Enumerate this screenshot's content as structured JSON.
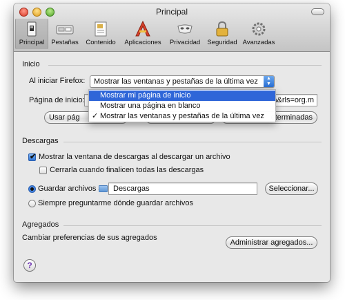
{
  "window": {
    "title": "Principal"
  },
  "toolbar": {
    "tabs": [
      {
        "label": "Principal",
        "icon": "switch-icon"
      },
      {
        "label": "Pestañas",
        "icon": "tabs-icon"
      },
      {
        "label": "Contenido",
        "icon": "content-icon"
      },
      {
        "label": "Aplicaciones",
        "icon": "applications-icon"
      },
      {
        "label": "Privacidad",
        "icon": "privacy-mask-icon"
      },
      {
        "label": "Seguridad",
        "icon": "padlock-icon"
      },
      {
        "label": "Avanzadas",
        "icon": "gear-icon"
      }
    ]
  },
  "inicio": {
    "section_title": "Inicio",
    "startup_label": "Al iniciar Firefox:",
    "startup_value": "Mostrar las ventanas y pestañas de la última vez",
    "homepage_label": "Página de inicio:",
    "homepage_value": "a&rls=org.m",
    "btn_current_visible": "Usar pág",
    "btn_default_visible": "eterminadas",
    "dropdown_options": [
      {
        "label": "Mostrar mi página de inicio",
        "highlighted": true,
        "checked": false
      },
      {
        "label": "Mostrar una página en blanco",
        "highlighted": false,
        "checked": false
      },
      {
        "label": "Mostrar las ventanas y pestañas de la última vez",
        "highlighted": false,
        "checked": true
      }
    ]
  },
  "descargas": {
    "section_title": "Descargas",
    "show_window_label": "Mostrar la ventana de descargas al descargar un archivo",
    "show_window_checked": true,
    "close_label": "Cerrarla cuando finalicen todas las descargas",
    "close_checked": false,
    "save_to_label": "Guardar archivos a",
    "save_to_folder": "Descargas",
    "choose_button": "Seleccionar...",
    "always_ask_label": "Siempre preguntarme dónde guardar archivos"
  },
  "agregados": {
    "section_title": "Agregados",
    "description": "Cambiar preferencias de sus agregados",
    "manage_button": "Administrar agregados..."
  },
  "help": {
    "label": "?"
  },
  "colors": {
    "highlight": "#2f66d8",
    "checkbox_accent": "#2f74d6"
  }
}
